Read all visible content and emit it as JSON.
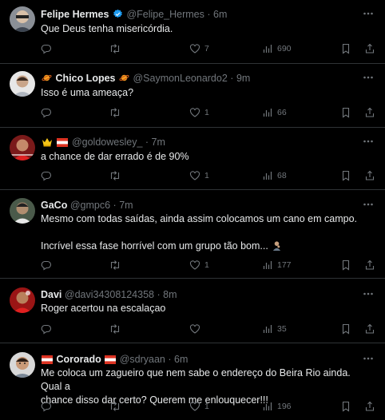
{
  "colors": {
    "background": "#000000",
    "text": "#e7e9ea",
    "muted": "#71767b",
    "divider": "#2f3336",
    "verified": "#1d9bf0"
  },
  "icons": {
    "reply": "reply-icon",
    "retweet": "retweet-icon",
    "like": "heart-icon",
    "views": "views-icon",
    "bookmark": "bookmark-icon",
    "share": "share-icon",
    "more": "more-icon"
  },
  "tweets": [
    {
      "name": "Felipe Hermes",
      "handle": "@Felipe_Hermes",
      "time": "6m",
      "text": [
        "Que Deus tenha misericórdia."
      ],
      "likes": "7",
      "views": "690"
    },
    {
      "name": "Chico Lopes",
      "handle": "@SaymonLeonardo2",
      "time": "9m",
      "text": [
        "Isso é uma ameaça?"
      ],
      "likes": "1",
      "views": "66"
    },
    {
      "name": "",
      "handle": "@goldowesley_",
      "time": "7m",
      "text": [
        "a chance de dar errado é de 90%"
      ],
      "likes": "1",
      "views": "68"
    },
    {
      "name": "GaCo",
      "handle": "@gmpc6",
      "time": "7m",
      "text": [
        "Mesmo com todas saídas, ainda assim colocamos um cano em campo.",
        "",
        "Incrível essa fase horrível com um grupo tão bom..."
      ],
      "likes": "1",
      "views": "177"
    },
    {
      "name": "Davi",
      "handle": "@davi34308124358",
      "time": "8m",
      "text": [
        "Roger acertou na escalaçao"
      ],
      "likes": "",
      "views": "35"
    },
    {
      "name": "Cororado",
      "handle": "@sdryaan",
      "time": "6m",
      "text": [
        "Me coloca um zagueiro que nem sabe o endereço do Beira Rio ainda. Qual a",
        "chance disso dar certo? Querem me enlouquecer!!!"
      ],
      "likes": "1",
      "views": "196"
    }
  ],
  "separator": "·"
}
